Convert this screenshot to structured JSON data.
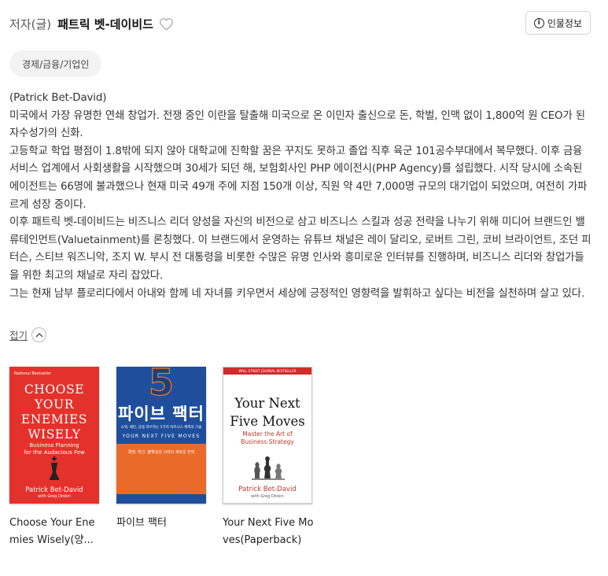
{
  "header": {
    "role": "저자(글)",
    "author_name": "패트릭 벳-데이비드",
    "favorite_icon": "heart-outline-icon",
    "info_button_label": "인물정보",
    "info_icon": "info-circle-icon"
  },
  "tag": {
    "label": "경제/금융/기업인"
  },
  "bio": {
    "paragraphs": [
      "(Patrick Bet-David)",
      "미국에서 가장 유명한 연쇄 창업가. 전쟁 중인 이란을 탈출해 미국으로 온 이민자 출신으로 돈, 학벌, 인맥 없이 1,800억 원 CEO가 된 자수성가의 신화.",
      "고등학교 학업 평점이 1.8밖에 되지 않아 대학교에 진학할 꿈은 꾸지도 못하고 졸업 직후 육군 101공수부대에서 복무했다. 이후 금융 서비스 업계에서 사회생활을 시작했으며 30세가 되던 해, 보험회사인 PHP 에이전시(PHP Agency)를 설립했다. 시작 당시에 소속된 에이전트는 66명에 불과했으나 현재 미국 49개 주에 지점 150개 이상, 직원 약 4만 7,000명 규모의 대기업이 되었으며, 여전히 가파르게 성장 중이다.",
      "이후 패트릭 벳-데이비드는 비즈니스 리더 양성을 자신의 비전으로 삼고 비즈니스 스킬과 성공 전략을 나누기 위해 미디어 브랜드인 밸류테인먼트(Valuetainment)를 론칭했다. 이 브랜드에서 운영하는 유튜브 채널은 레이 달리오, 로버트 그린, 코비 브라이언트, 조던 피터슨, 스티브 워즈니악, 조지 W. 부시 전 대통령을 비롯한 수많은 유명 인사와 흥미로운 인터뷰를 진행하며, 비즈니스 리더와 창업가들을 위한 최고의 채널로 자리 잡았다.",
      "그는 현재 남부 플로리다에서 아내와 함께 네 자녀를 키우면서 세상에 긍정적인 영향력을 발휘하고 싶다는 비전을 실천하며 살고 있다."
    ]
  },
  "collapse": {
    "label": "접기",
    "icon": "chevron-up-icon"
  },
  "books": [
    {
      "title": "Choose Your Enemies Wisely(양...",
      "cover": {
        "badge": "National Bestseller",
        "title_lines": [
          "CHOOSE",
          "YOUR",
          "ENEMIES",
          "WISELY"
        ],
        "subtitle_lines": [
          "Business Planning",
          "for the Audacious Few"
        ],
        "author": "Patrick Bet-David",
        "coauthor": "with Greg Dinkin",
        "color": "#e5312b"
      }
    },
    {
      "title": "파이브 팩터",
      "cover": {
        "number": "5",
        "title_ko": "파이브 팩터",
        "tagline": "소택, 패턴, 운을 좌우하는 5가지 비즈니스 체력의 기술",
        "title_en": "YOUR NEXT FIVE MOVES",
        "blurb": "경쟁, 혁신, 불확실성 시대의 새로운 전략",
        "color": "#1f4f9c",
        "accent": "#ea6a2a"
      }
    },
    {
      "title": "Your Next Five Moves(Paperback)",
      "cover": {
        "banner": "WALL STREET JOURNAL BESTSELLER",
        "title_lines": [
          "Your Next",
          "Five Moves"
        ],
        "subtitle_lines": [
          "Master the Art of",
          "Business Strategy"
        ],
        "author": "Patrick Bet-David",
        "coauthor": "with Greg Dinkin",
        "color": "#c0392b"
      }
    }
  ]
}
